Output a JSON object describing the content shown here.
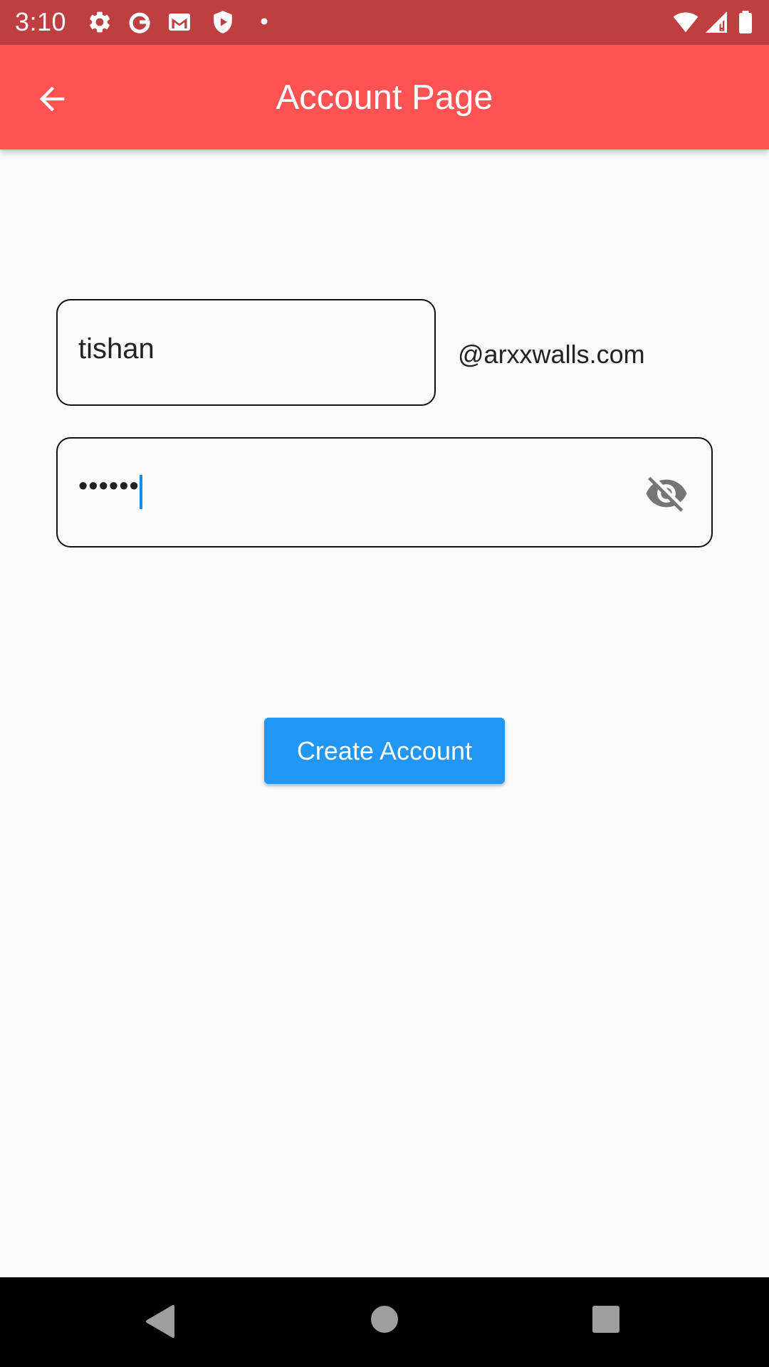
{
  "status_bar": {
    "time": "3:10",
    "icons": [
      "settings-gear-icon",
      "google-g-icon",
      "gmail-icon",
      "shield-play-icon",
      "dot-icon",
      "wifi-icon",
      "cell-signal-icon",
      "battery-icon"
    ]
  },
  "app_bar": {
    "back_icon": "arrow-back-icon",
    "title": "Account Page"
  },
  "form": {
    "username_value": "tishan",
    "domain_suffix": "@arxxwalls.com",
    "password_value": "••••••",
    "visibility_icon": "visibility-off-icon"
  },
  "actions": {
    "create_account_label": "Create Account"
  },
  "nav_bar": {
    "icons": [
      "back-triangle-icon",
      "home-circle-icon",
      "recents-square-icon"
    ]
  },
  "colors": {
    "status_bar": "#bf3e40",
    "app_bar": "#fe5253",
    "background": "#fafafa",
    "button": "#2196f3",
    "caret": "#1e88e5",
    "nav_bar": "#000000"
  }
}
